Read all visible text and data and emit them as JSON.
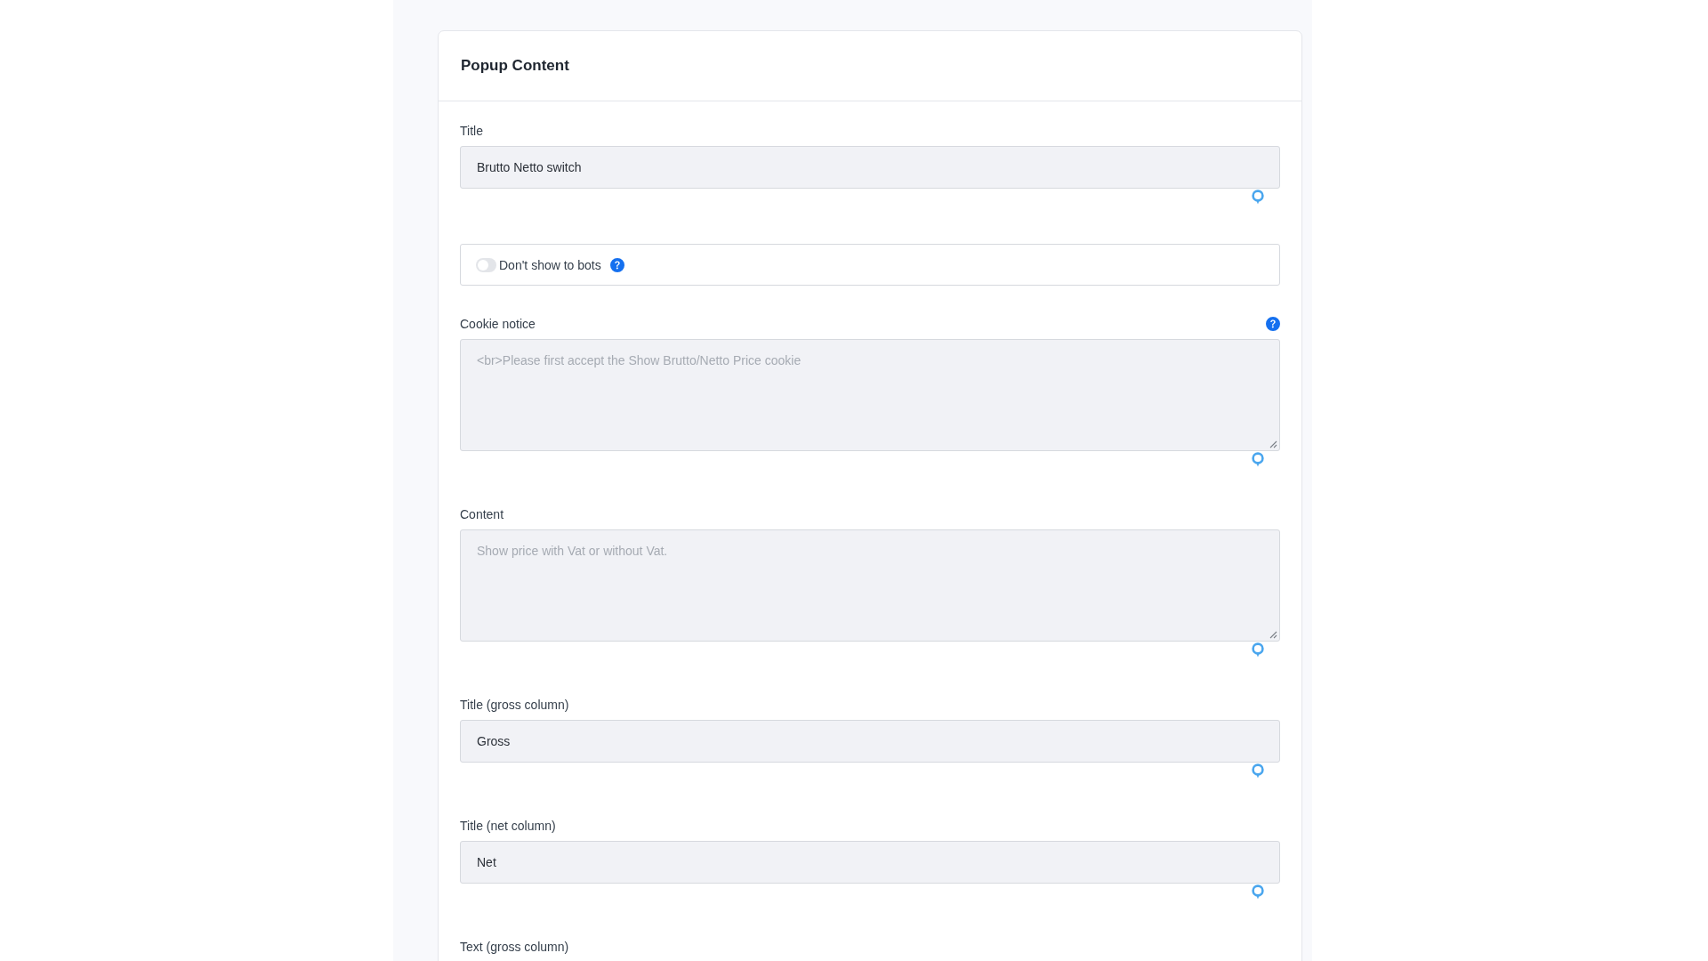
{
  "card": {
    "title": "Popup Content"
  },
  "fields": [
    {
      "kind": "input",
      "label": "Title",
      "value": "Brutto Netto switch",
      "help": false
    },
    {
      "kind": "toggle",
      "label": "Don't show to bots",
      "on": false,
      "help": true
    },
    {
      "kind": "textarea",
      "label": "Cookie notice",
      "placeholder": "<br>Please first accept the Show Brutto/Netto Price cookie",
      "help": true
    },
    {
      "kind": "textarea",
      "label": "Content",
      "placeholder": "Show price with Vat or without Vat.",
      "help": false
    },
    {
      "kind": "input",
      "label": "Title (gross column)",
      "value": "Gross",
      "help": false
    },
    {
      "kind": "input",
      "label": "Title (net column)",
      "value": "Net",
      "help": false
    },
    {
      "kind": "label",
      "label": "Text (gross column)",
      "help": false
    }
  ]
}
